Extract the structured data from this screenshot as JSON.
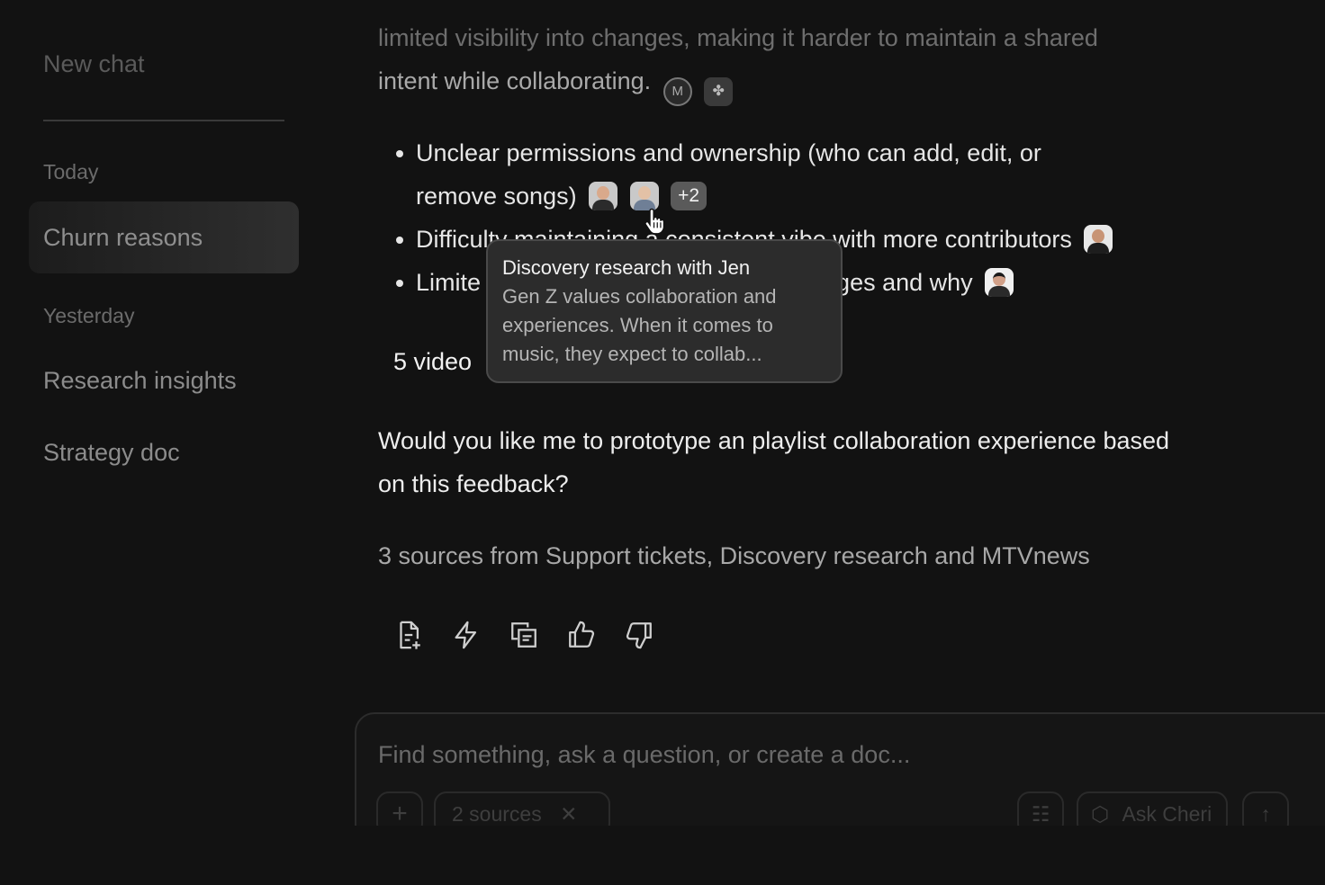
{
  "sidebar": {
    "new_chat": "New chat",
    "sections": [
      {
        "label": "Today",
        "items": [
          "Churn reasons"
        ]
      },
      {
        "label": "Yesterday",
        "items": [
          "Research insights",
          "Strategy doc"
        ]
      }
    ],
    "active_item": "Churn reasons"
  },
  "main": {
    "intro_line1": "limited visibility into changes, making it harder to maintain a shared",
    "intro_line2": "intent while collaborating.",
    "bullets": [
      {
        "line1": "Unclear permissions and ownership (who can add, edit, or",
        "line2": "remove songs)",
        "extra_count": "+2"
      },
      {
        "text": "Difficulty maintaining a consistent vibe with more contributors"
      },
      {
        "start": "Limite",
        "end": "nges and why"
      }
    ],
    "video_line": "5 video",
    "question": "Would you like me to prototype an playlist collaboration experience based on this feedback?",
    "sources_line": "3 sources from Support tickets, Discovery research and MTVnews"
  },
  "tooltip": {
    "title": "Discovery research with Jen",
    "body": "Gen Z values collaboration and experiences. When it comes to music, they expect to collab..."
  },
  "composer": {
    "placeholder": "Find something, ask a question, or create a doc...",
    "sources_chip": "2 sources",
    "ask_button": "Ask Cheri"
  },
  "icons": [
    "m-logo-icon",
    "figma-like-logo-icon",
    "file-add-icon",
    "lightning-icon",
    "copy-icon",
    "thumbs-up-icon",
    "thumbs-down-icon",
    "hand-cursor-icon"
  ]
}
